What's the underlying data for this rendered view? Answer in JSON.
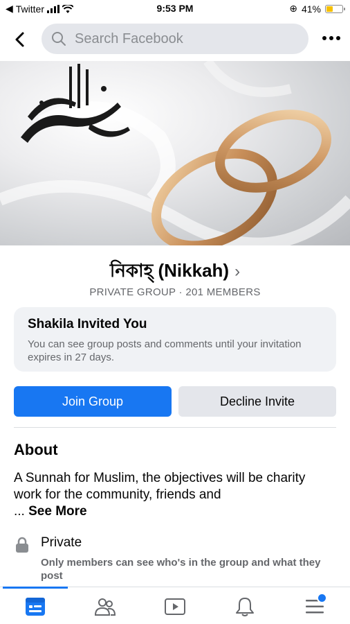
{
  "status_bar": {
    "back_app": "Twitter",
    "time": "9:53 PM",
    "battery": "41%",
    "battery_level": 0.41
  },
  "nav": {
    "search_placeholder": "Search Facebook"
  },
  "group": {
    "name": "নিকাহ্ (Nikkah)",
    "chevron": "›",
    "meta": "PRIVATE GROUP · 201 MEMBERS"
  },
  "invite": {
    "title": "Shakila Invited You",
    "description": "You can see group posts and comments until your invitation expires in 27 days."
  },
  "buttons": {
    "join": "Join Group",
    "decline": "Decline Invite"
  },
  "about": {
    "heading": "About",
    "text": "A Sunnah for Muslim, the objectives will be charity work for the community, friends and",
    "ellipsis": "...",
    "see_more": "See More"
  },
  "privacy": {
    "title": "Private",
    "description": "Only members can see who's in the group and what they post"
  },
  "tabs": [
    {
      "icon": "news-feed-icon",
      "active": true
    },
    {
      "icon": "groups-icon",
      "active": false
    },
    {
      "icon": "watch-icon",
      "active": false
    },
    {
      "icon": "notifications-icon",
      "active": false
    },
    {
      "icon": "menu-icon",
      "active": false,
      "badge": true
    }
  ],
  "colors": {
    "accent": "#1877f2",
    "secondary_text": "#65676b",
    "surface": "#f0f2f5"
  }
}
